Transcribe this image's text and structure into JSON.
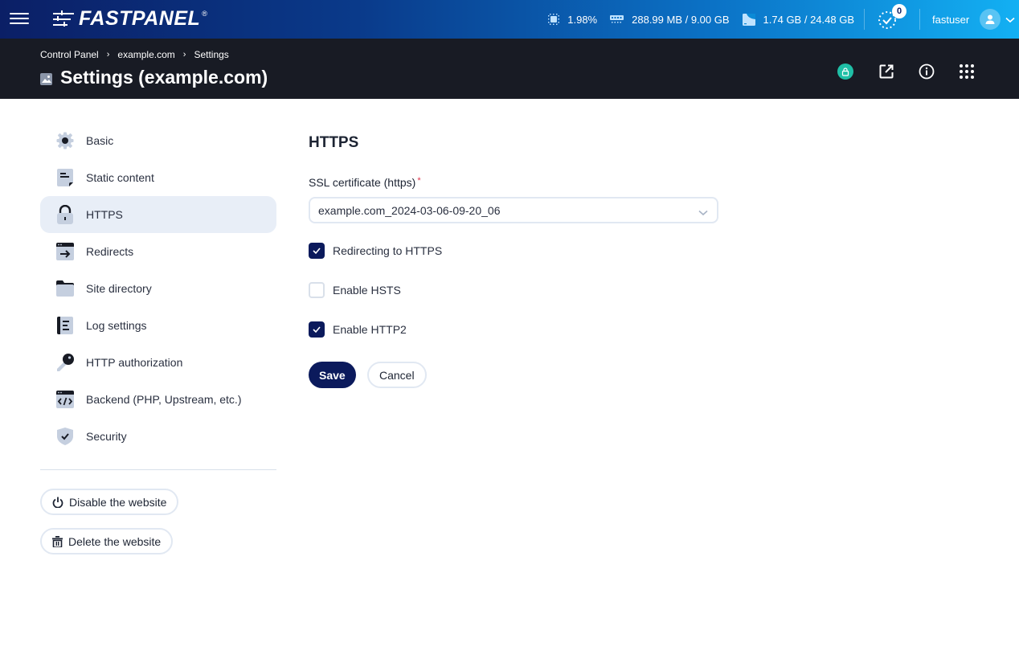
{
  "topbar": {
    "logo_text": "FASTPANEL",
    "logo_reg": "®",
    "cpu": {
      "icon": "cpu-icon",
      "value": "1.98%"
    },
    "memory": {
      "icon": "memory-icon",
      "value": "288.99 MB / 9.00 GB"
    },
    "disk": {
      "icon": "disk-icon",
      "value": "1.74 GB / 24.48 GB"
    },
    "tasks": {
      "icon": "tasks-icon",
      "count": "0"
    },
    "user": {
      "name": "fastuser",
      "icon": "user-icon"
    }
  },
  "pagehead": {
    "breadcrumb": [
      "Control Panel",
      "example.com",
      "Settings"
    ],
    "breadcrumb_sep": "›",
    "title": "Settings (example.com)",
    "actions": [
      "ssl-lock-icon",
      "external-link-icon",
      "info-icon",
      "apps-grid-icon"
    ]
  },
  "sidebar": {
    "items": [
      {
        "label": "Basic",
        "icon": "gear-icon",
        "active": false
      },
      {
        "label": "Static content",
        "icon": "document-icon",
        "active": false
      },
      {
        "label": "HTTPS",
        "icon": "lock-icon",
        "active": true
      },
      {
        "label": "Redirects",
        "icon": "redirect-icon",
        "active": false
      },
      {
        "label": "Site directory",
        "icon": "folder-icon",
        "active": false
      },
      {
        "label": "Log settings",
        "icon": "log-icon",
        "active": false
      },
      {
        "label": "HTTP authorization",
        "icon": "key-icon",
        "active": false
      },
      {
        "label": "Backend (PHP, Upstream, etc.)",
        "icon": "code-icon",
        "active": false
      },
      {
        "label": "Security",
        "icon": "shield-icon",
        "active": false
      }
    ],
    "disable_label": "Disable the website",
    "delete_label": "Delete the website"
  },
  "content": {
    "section_title": "HTTPS",
    "ssl_label": "SSL certificate (https)",
    "ssl_required_mark": "*",
    "ssl_value": "example.com_2024-03-06-09-20_06",
    "checkboxes": [
      {
        "label": "Redirecting to HTTPS",
        "checked": true
      },
      {
        "label": "Enable HSTS",
        "checked": false
      },
      {
        "label": "Enable HTTP2",
        "checked": true
      }
    ],
    "save_label": "Save",
    "cancel_label": "Cancel"
  },
  "colors": {
    "primary": "#0b1a5c",
    "header_dark": "#181b24",
    "active_bg": "#e8eef7",
    "ssl_badge": "#1fbfa6",
    "required": "#e0344b"
  }
}
